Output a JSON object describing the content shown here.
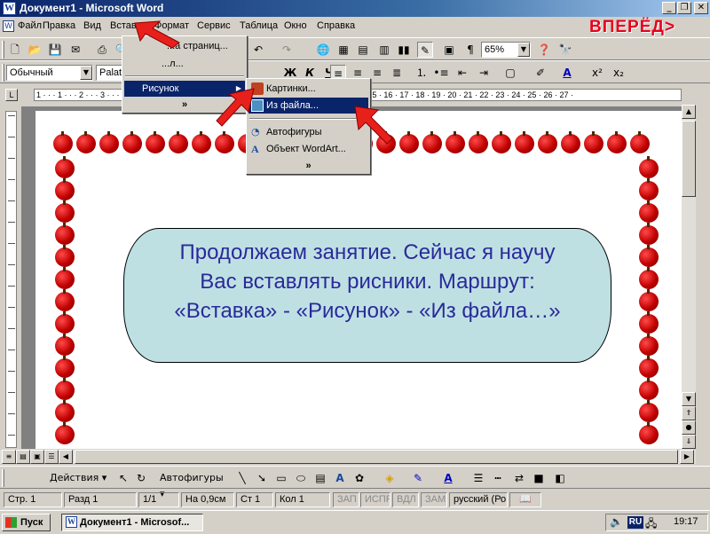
{
  "window": {
    "title": "Документ1 - Microsoft Word"
  },
  "window_buttons": [
    "_",
    "❐",
    "✕"
  ],
  "doc_buttons": [
    "_",
    "❐",
    "✕"
  ],
  "menubar": [
    "Файл",
    "Правка",
    "Вид",
    "Вставка",
    "Формат",
    "Сервис",
    "Таблица",
    "Окно",
    "Справка"
  ],
  "forward_label": "ВПЕРЁД>",
  "toolbar": {
    "style": "Обычный",
    "font": "Palati",
    "zoom": "65%",
    "bold": "Ж",
    "italic": "К",
    "underline": "Ч"
  },
  "insert_menu": {
    "item_page_numbers": "...а страниц...",
    "item_symbol": "...л...",
    "item_picture": "Рисунок",
    "more": "»"
  },
  "picture_submenu": {
    "clipart": "Картинки...",
    "from_file": "Из файла...",
    "autoshapes": "Автофигуры",
    "wordart": "Объект WordArt...",
    "more": "»"
  },
  "ruler": {
    "h_marks": "1 · · · 1 · · · 2 · · · 3 · · · 4 · · · 5 · · · 6 · · · 7 · · · 8 · · · 9 · · · 10 · · · 11 · · · 12 · · · 13 · · · 14 · 15 · 16 · 17 · 18 · 19 · 20 · 21 · 22 · 23 · 24 · 25 · 26 · 27 ·"
  },
  "document": {
    "callout_lines": [
      "Продолжаем занятие. Сейчас я научу",
      "Вас вставлять рисники. Маршрут:",
      "«Вставка» - «Рисунок» - «Из файла…»"
    ]
  },
  "drawing_toolbar": {
    "actions": "Действия",
    "autoshapes": "Автофигуры"
  },
  "statusbar": {
    "page": "Стр. 1",
    "section": "Разд 1",
    "pages": "1/1",
    "at": "На 0,9см",
    "line": "Ст 1",
    "col": "Кол 1",
    "rec": "ЗАП",
    "trk": "ИСПР",
    "ext": "ВДЛ",
    "ovr": "ЗАМ",
    "lang": "русский (Ро"
  },
  "taskbar": {
    "start": "Пуск",
    "task": "Документ1 - Microsof...",
    "lang": "RU",
    "clock": "19:17"
  },
  "colors": {
    "accent": "#e8001c",
    "highlight": "#0a246a",
    "callout": "#bfe0e3",
    "callout_text": "#2a2a9a"
  }
}
